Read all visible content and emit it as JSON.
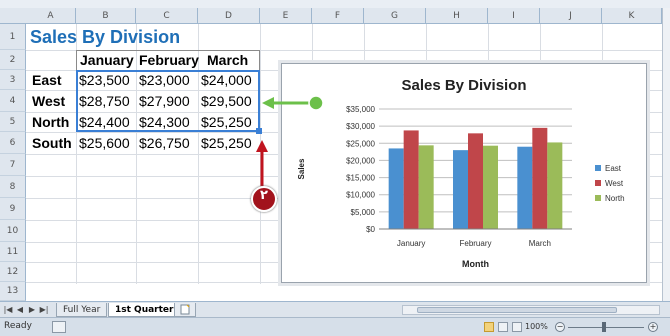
{
  "column_headers": [
    "A",
    "B",
    "C",
    "D",
    "E",
    "F",
    "G",
    "H",
    "I",
    "J",
    "K"
  ],
  "row_headers": [
    "1",
    "2",
    "3",
    "4",
    "5",
    "6",
    "7",
    "8",
    "9",
    "10",
    "11",
    "12",
    "13"
  ],
  "sheet": {
    "title": "Sales By Division",
    "months": [
      "January",
      "February",
      "March"
    ],
    "rows": [
      {
        "division": "East",
        "values": [
          "$23,500",
          "$23,000",
          "$24,000"
        ]
      },
      {
        "division": "West",
        "values": [
          "$28,750",
          "$27,900",
          "$29,500"
        ]
      },
      {
        "division": "North",
        "values": [
          "$24,400",
          "$24,300",
          "$25,250"
        ]
      },
      {
        "division": "South",
        "values": [
          "$25,600",
          "$26,750",
          "$25,250"
        ]
      }
    ]
  },
  "chart_data": {
    "type": "bar",
    "title": "Sales By Division",
    "xlabel": "Month",
    "ylabel": "Sales",
    "categories": [
      "January",
      "February",
      "March"
    ],
    "series": [
      {
        "name": "East",
        "values": [
          23500,
          23000,
          24000
        ],
        "color": "#4a90d0"
      },
      {
        "name": "West",
        "values": [
          28750,
          27900,
          29500
        ],
        "color": "#c0464a"
      },
      {
        "name": "North",
        "values": [
          24400,
          24300,
          25250
        ],
        "color": "#9bbb59"
      }
    ],
    "ylim": [
      0,
      35000
    ],
    "yticks": [
      "$35,000",
      "$30,000",
      "$25,000",
      "$20,000",
      "$15,000",
      "$10,000",
      "$5,000",
      "$0"
    ],
    "grid": true,
    "legend": "right"
  },
  "annotation": {
    "step": "٢",
    "badge_color": "#a2131c",
    "arrow_color": "#c0141f",
    "pointer_color": "#6cc04a"
  },
  "tabs": {
    "nav": [
      "|◀",
      "◀",
      "▶",
      "▶|"
    ],
    "sheets": [
      "Full Year",
      "1st Quarter"
    ],
    "active": "1st Quarter"
  },
  "status": {
    "text": "Ready",
    "zoom": "100%",
    "zoom_out": "−",
    "zoom_in": "+"
  }
}
